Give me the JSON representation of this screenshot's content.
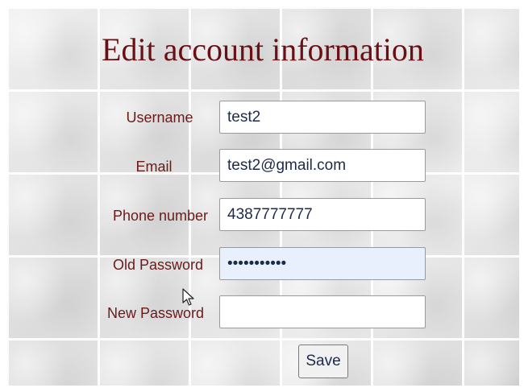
{
  "form": {
    "title": "Edit account information",
    "fields": [
      {
        "label": "Username",
        "value": "test2",
        "type": "text"
      },
      {
        "label": "Email",
        "value": "test2@gmail.com",
        "type": "text"
      },
      {
        "label": "Phone number",
        "value": "4387777777",
        "type": "text"
      },
      {
        "label": "Old Password",
        "value": "12345678901",
        "type": "password"
      },
      {
        "label": "New Password",
        "value": "",
        "type": "password"
      }
    ],
    "save_label": "Save"
  },
  "colors": {
    "title": "#6b0f14",
    "label": "#6b1a1a",
    "input_text": "#1d2a4a",
    "autofill_bg": "#e8f0fe"
  },
  "icons": {
    "cursor": "mouse-pointer-icon"
  }
}
